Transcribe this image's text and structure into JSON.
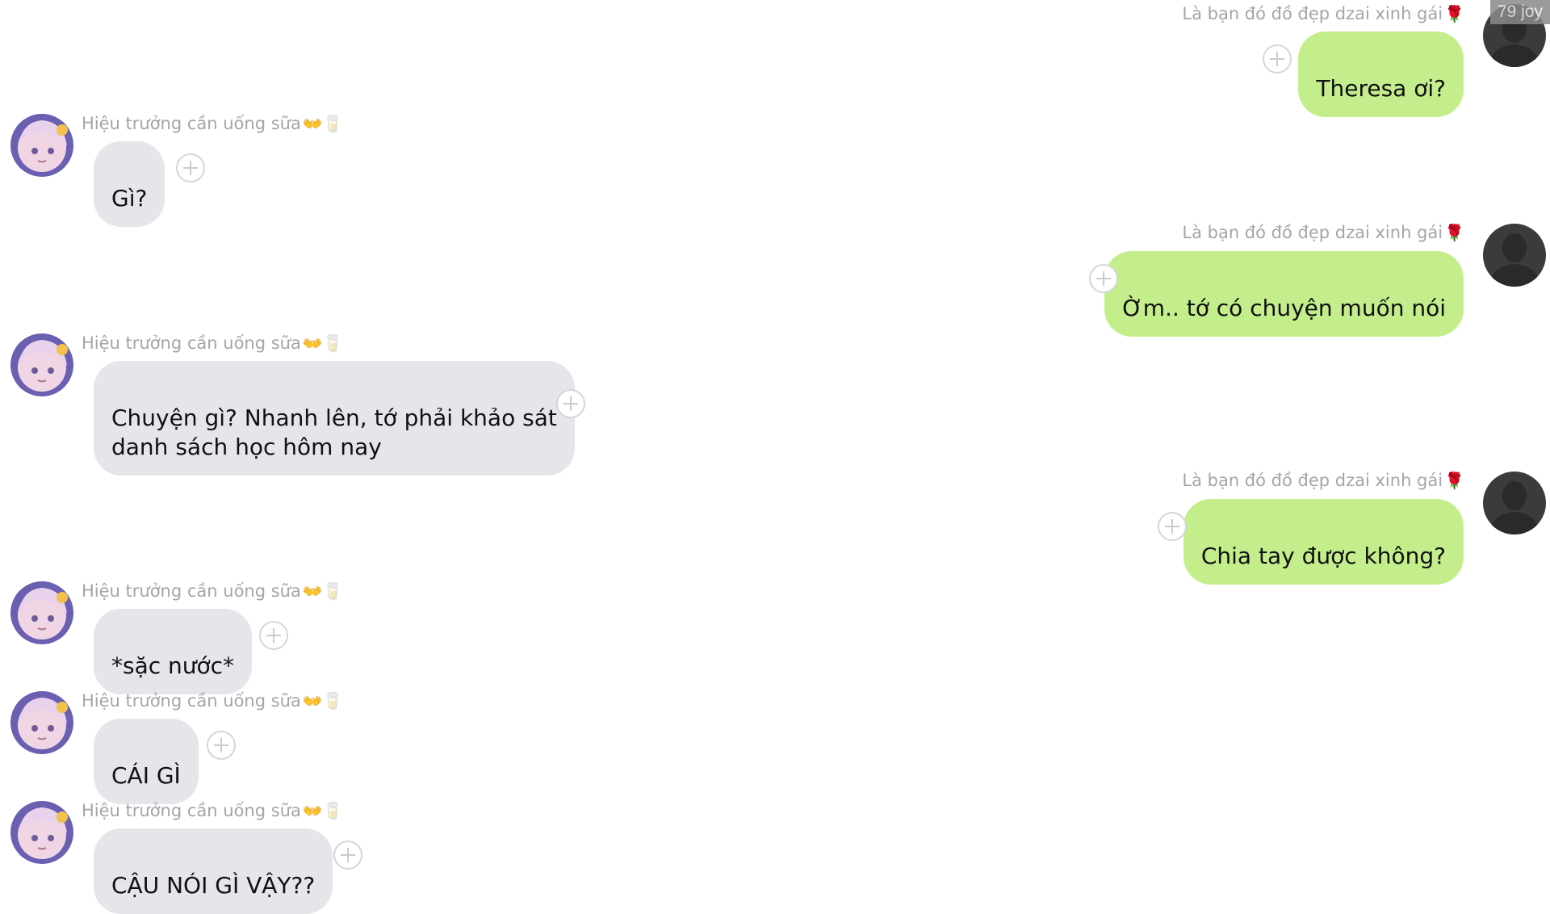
{
  "watermark": "79 joy",
  "participants": {
    "self": {
      "name": "Là bạn đó đồ đẹp dzai xinh gái",
      "emoji": "🌹",
      "avatar_icon": "default-user-silhouette"
    },
    "other": {
      "name": "Hiệu trưởng cần uống sữa",
      "emoji": "👐🥛",
      "avatar_icon": "anime-girl-avatar"
    }
  },
  "messages": [
    {
      "side": "out",
      "sender": "Là bạn đó đồ đẹp dzai xinh gái",
      "sender_emoji": "🌹",
      "text": "Theresa ơi?"
    },
    {
      "side": "in",
      "sender": "Hiệu trưởng cần uống sữa",
      "sender_emoji": "👐🥛",
      "text": "Gì?"
    },
    {
      "side": "out",
      "sender": "Là bạn đó đồ đẹp dzai xinh gái",
      "sender_emoji": "🌹",
      "text": "Ờm.. tớ có chuyện muốn nói"
    },
    {
      "side": "in",
      "sender": "Hiệu trưởng cần uống sữa",
      "sender_emoji": "👐🥛",
      "text": "Chuyện gì? Nhanh lên, tớ phải khảo sát\ndanh sách học hôm nay"
    },
    {
      "side": "out",
      "sender": "Là bạn đó đồ đẹp dzai xinh gái",
      "sender_emoji": "🌹",
      "text": "Chia tay được không?"
    },
    {
      "side": "in",
      "sender": "Hiệu trưởng cần uống sữa",
      "sender_emoji": "👐🥛",
      "text": "*sặc nước*"
    },
    {
      "side": "in",
      "sender": "Hiệu trưởng cần uống sữa",
      "sender_emoji": "👐🥛",
      "text": "CÁI GÌ"
    },
    {
      "side": "in",
      "sender": "Hiệu trưởng cần uống sữa",
      "sender_emoji": "👐🥛",
      "text": "CẬU NÓI GÌ VẬY??"
    }
  ],
  "colors": {
    "incoming_bubble": "#e5e6ea",
    "outgoing_bubble": "#c4ee8c",
    "sender_name": "#a2a5aa",
    "background": "#ffffff"
  }
}
